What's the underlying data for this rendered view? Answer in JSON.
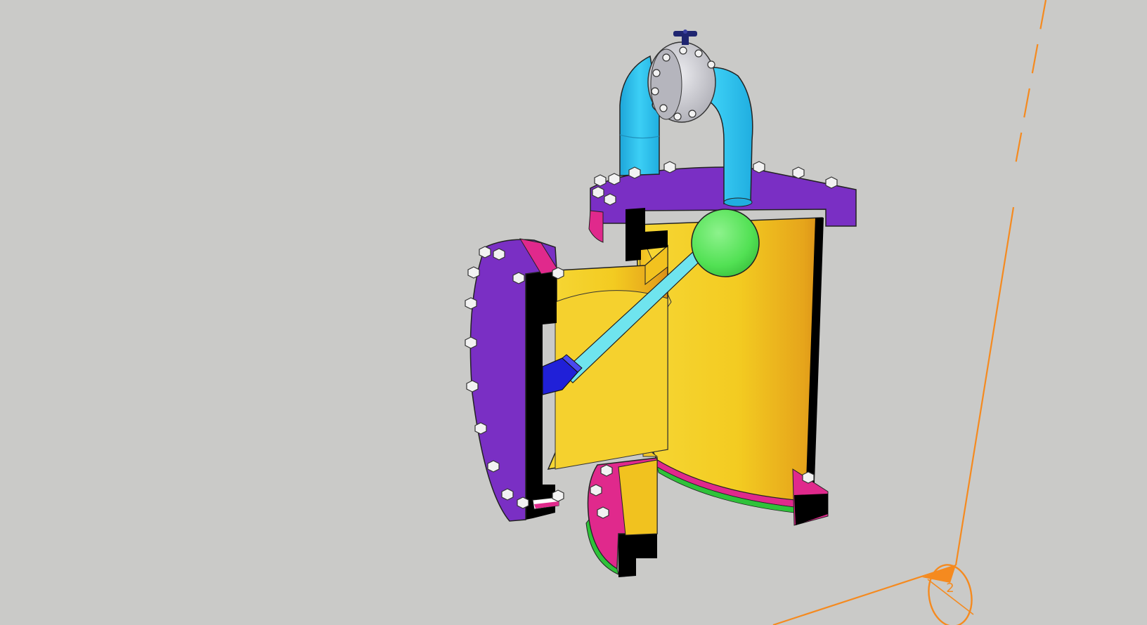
{
  "viewport": {
    "background_color": "#cacac8",
    "section_plane_label": "2"
  },
  "colors": {
    "flange_purple": "#7a2fc4",
    "flange_purple_dark": "#5f1fa0",
    "gasket_magenta": "#e0298c",
    "gasket_green": "#2fc23a",
    "body_yellow": "#f4cd24",
    "body_yellow_shade": "#e8a91c",
    "body_yellow_light": "#fbe150",
    "pipe_cyan": "#27bde8",
    "pipe_cyan_light": "#4fd6f7",
    "float_green": "#58e85a",
    "lever_cyan": "#6fe4ee",
    "lever_blue": "#2020d8",
    "section_cut_black": "#000000",
    "bolt_white": "#f2f2f2",
    "valve_steel": "#c9c9cf",
    "handwheel_navy": "#1f2570",
    "section_marker_orange": "#f58a1f"
  },
  "icons": {
    "section_plane": "section-plane-icon"
  }
}
